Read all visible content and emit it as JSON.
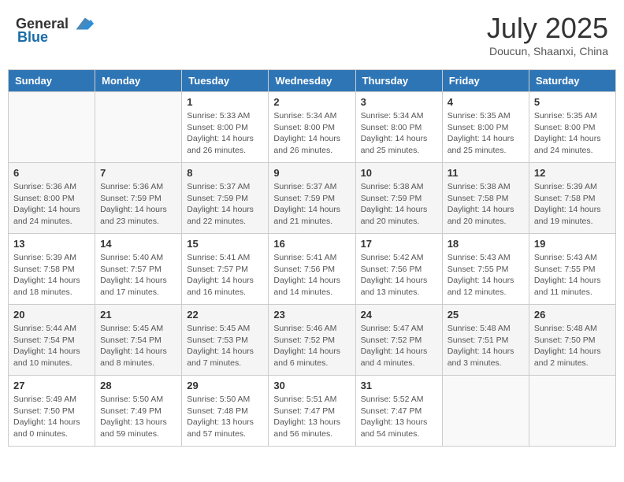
{
  "header": {
    "logo_general": "General",
    "logo_blue": "Blue",
    "month_title": "July 2025",
    "location": "Doucun, Shaanxi, China"
  },
  "days_of_week": [
    "Sunday",
    "Monday",
    "Tuesday",
    "Wednesday",
    "Thursday",
    "Friday",
    "Saturday"
  ],
  "weeks": [
    [
      {
        "day": "",
        "info": ""
      },
      {
        "day": "",
        "info": ""
      },
      {
        "day": "1",
        "info": "Sunrise: 5:33 AM\nSunset: 8:00 PM\nDaylight: 14 hours and 26 minutes."
      },
      {
        "day": "2",
        "info": "Sunrise: 5:34 AM\nSunset: 8:00 PM\nDaylight: 14 hours and 26 minutes."
      },
      {
        "day": "3",
        "info": "Sunrise: 5:34 AM\nSunset: 8:00 PM\nDaylight: 14 hours and 25 minutes."
      },
      {
        "day": "4",
        "info": "Sunrise: 5:35 AM\nSunset: 8:00 PM\nDaylight: 14 hours and 25 minutes."
      },
      {
        "day": "5",
        "info": "Sunrise: 5:35 AM\nSunset: 8:00 PM\nDaylight: 14 hours and 24 minutes."
      }
    ],
    [
      {
        "day": "6",
        "info": "Sunrise: 5:36 AM\nSunset: 8:00 PM\nDaylight: 14 hours and 24 minutes."
      },
      {
        "day": "7",
        "info": "Sunrise: 5:36 AM\nSunset: 7:59 PM\nDaylight: 14 hours and 23 minutes."
      },
      {
        "day": "8",
        "info": "Sunrise: 5:37 AM\nSunset: 7:59 PM\nDaylight: 14 hours and 22 minutes."
      },
      {
        "day": "9",
        "info": "Sunrise: 5:37 AM\nSunset: 7:59 PM\nDaylight: 14 hours and 21 minutes."
      },
      {
        "day": "10",
        "info": "Sunrise: 5:38 AM\nSunset: 7:59 PM\nDaylight: 14 hours and 20 minutes."
      },
      {
        "day": "11",
        "info": "Sunrise: 5:38 AM\nSunset: 7:58 PM\nDaylight: 14 hours and 20 minutes."
      },
      {
        "day": "12",
        "info": "Sunrise: 5:39 AM\nSunset: 7:58 PM\nDaylight: 14 hours and 19 minutes."
      }
    ],
    [
      {
        "day": "13",
        "info": "Sunrise: 5:39 AM\nSunset: 7:58 PM\nDaylight: 14 hours and 18 minutes."
      },
      {
        "day": "14",
        "info": "Sunrise: 5:40 AM\nSunset: 7:57 PM\nDaylight: 14 hours and 17 minutes."
      },
      {
        "day": "15",
        "info": "Sunrise: 5:41 AM\nSunset: 7:57 PM\nDaylight: 14 hours and 16 minutes."
      },
      {
        "day": "16",
        "info": "Sunrise: 5:41 AM\nSunset: 7:56 PM\nDaylight: 14 hours and 14 minutes."
      },
      {
        "day": "17",
        "info": "Sunrise: 5:42 AM\nSunset: 7:56 PM\nDaylight: 14 hours and 13 minutes."
      },
      {
        "day": "18",
        "info": "Sunrise: 5:43 AM\nSunset: 7:55 PM\nDaylight: 14 hours and 12 minutes."
      },
      {
        "day": "19",
        "info": "Sunrise: 5:43 AM\nSunset: 7:55 PM\nDaylight: 14 hours and 11 minutes."
      }
    ],
    [
      {
        "day": "20",
        "info": "Sunrise: 5:44 AM\nSunset: 7:54 PM\nDaylight: 14 hours and 10 minutes."
      },
      {
        "day": "21",
        "info": "Sunrise: 5:45 AM\nSunset: 7:54 PM\nDaylight: 14 hours and 8 minutes."
      },
      {
        "day": "22",
        "info": "Sunrise: 5:45 AM\nSunset: 7:53 PM\nDaylight: 14 hours and 7 minutes."
      },
      {
        "day": "23",
        "info": "Sunrise: 5:46 AM\nSunset: 7:52 PM\nDaylight: 14 hours and 6 minutes."
      },
      {
        "day": "24",
        "info": "Sunrise: 5:47 AM\nSunset: 7:52 PM\nDaylight: 14 hours and 4 minutes."
      },
      {
        "day": "25",
        "info": "Sunrise: 5:48 AM\nSunset: 7:51 PM\nDaylight: 14 hours and 3 minutes."
      },
      {
        "day": "26",
        "info": "Sunrise: 5:48 AM\nSunset: 7:50 PM\nDaylight: 14 hours and 2 minutes."
      }
    ],
    [
      {
        "day": "27",
        "info": "Sunrise: 5:49 AM\nSunset: 7:50 PM\nDaylight: 14 hours and 0 minutes."
      },
      {
        "day": "28",
        "info": "Sunrise: 5:50 AM\nSunset: 7:49 PM\nDaylight: 13 hours and 59 minutes."
      },
      {
        "day": "29",
        "info": "Sunrise: 5:50 AM\nSunset: 7:48 PM\nDaylight: 13 hours and 57 minutes."
      },
      {
        "day": "30",
        "info": "Sunrise: 5:51 AM\nSunset: 7:47 PM\nDaylight: 13 hours and 56 minutes."
      },
      {
        "day": "31",
        "info": "Sunrise: 5:52 AM\nSunset: 7:47 PM\nDaylight: 13 hours and 54 minutes."
      },
      {
        "day": "",
        "info": ""
      },
      {
        "day": "",
        "info": ""
      }
    ]
  ]
}
